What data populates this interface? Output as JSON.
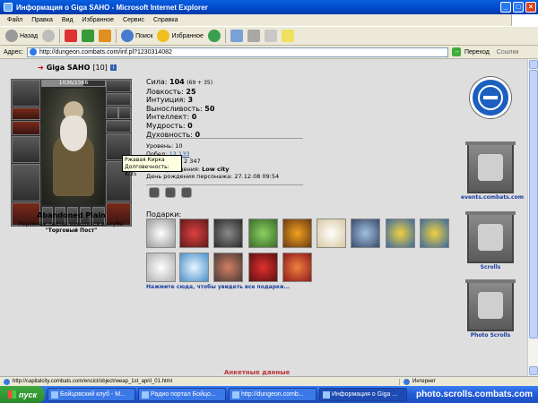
{
  "window": {
    "title": "Информация о Giga SAHO - Microsoft Internet Explorer"
  },
  "menu": [
    "Файл",
    "Правка",
    "Вид",
    "Избранное",
    "Сервис",
    "Справка"
  ],
  "toolbar": {
    "back": "Назад",
    "search": "Поиск",
    "favorites": "Избранное"
  },
  "address": {
    "label": "Адрес:",
    "url": "http://dungeon.combats.com/inf.pl?1230314082",
    "go": "Переход",
    "links": "Ссылки"
  },
  "character": {
    "name": "Giga SAHO",
    "level": "[10]",
    "hp": "1036/1566",
    "hp_fraction": 0.66,
    "location": "Abandoned Plain",
    "club_text": "Персонаж сейчас находится в клубе.",
    "club_name": "\"Торговый Пост\""
  },
  "tooltip": {
    "line1": "Ржавая Кирка",
    "line2": "Долговечность: 8/35"
  },
  "stats": [
    {
      "label": "Сила:",
      "value": "104",
      "extra": "(69 + 35)"
    },
    {
      "label": "Ловкость:",
      "value": "25"
    },
    {
      "label": "Интуиция:",
      "value": "3"
    },
    {
      "label": "Выносливость:",
      "value": "50"
    },
    {
      "label": "Интеллект:",
      "value": "0"
    },
    {
      "label": "Мудрость:",
      "value": "0"
    },
    {
      "label": "Духовность:",
      "value": "0"
    }
  ],
  "info": {
    "level_label": "Уровень:",
    "level_value": "10",
    "wins_label": "Побед:",
    "wins_value": "12 133",
    "third_value": "2 347",
    "birthplace_label": "Место рождения:",
    "birthplace_value": "Low city",
    "birthday_label": "День рождения персонажа:",
    "birthday_value": "27.12.08 09:54"
  },
  "gifts": {
    "label": "Подарки:",
    "note": "Нажмите сюда, чтобы увидеть все подарки..."
  },
  "right": {
    "events_label": "events.combats.com",
    "scrolls_label": "Scrolls",
    "photo_label": "Photo Scrolls",
    "banner_text": "events"
  },
  "footer_text": "Анкетные данные",
  "statusbar": {
    "url": "http://capitalcity.combats.com/encicl/object/weap_1st_april_01.html",
    "zone": "Интернет"
  },
  "taskbar": {
    "start": "пуск",
    "tasks": [
      "Бойцовский клуб - M...",
      "Радио портал Бойцо...",
      "http://dungeon.comb...",
      "Информация о Giga ..."
    ],
    "watermark": "photo.scrolls.combats.com"
  },
  "colors": {
    "title_blue": "#0048c8",
    "content_bg": "#dedede",
    "link_blue": "#1a3ea0",
    "taskbar_blue": "#245edb",
    "start_green": "#2b8a2b"
  }
}
